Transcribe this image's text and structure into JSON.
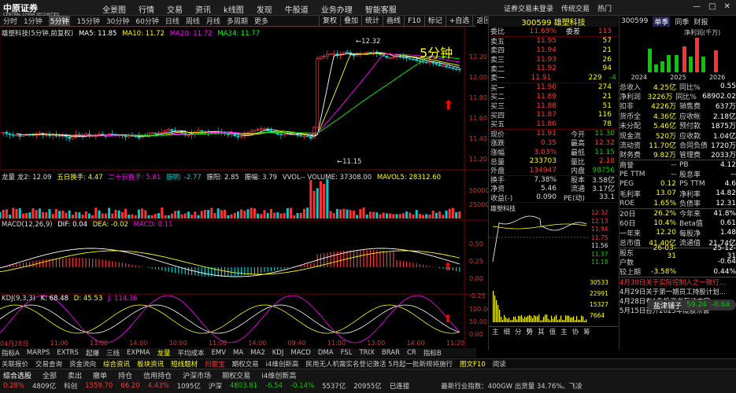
{
  "topbar": {
    "logo": "中原证券",
    "logo_sub": "CENTRAL CHINA SECURITIES",
    "menu": [
      "全景图",
      "行情",
      "交易",
      "资讯",
      "k线图",
      "发现",
      "牛股道",
      "业务办理",
      "智能客服"
    ],
    "right": [
      "证券交易未登录",
      "传统交易",
      "热门",
      "窗",
      "●"
    ]
  },
  "tabs": [
    "分时",
    "1分钟",
    "5分钟",
    "15分钟",
    "30分钟",
    "60分钟",
    "日线",
    "周线",
    "月线",
    "多周期",
    "更多"
  ],
  "tools": [
    "复权",
    "叠加",
    "统计",
    "画线",
    "F10",
    "标记",
    "+自选",
    "返回"
  ],
  "main": {
    "title": "雄塑科技(5分钟,前复权)",
    "ma": [
      {
        "t": "MA5: 11.85",
        "c": "#fff"
      },
      {
        "t": "MA10: 11.72",
        "c": "#ff0"
      },
      {
        "t": "MA20: 11.72",
        "c": "#f0f"
      },
      {
        "t": "MA34: 11.77",
        "c": "#0f0"
      }
    ],
    "label": "5分钟",
    "high": "12.32",
    "low": "11.15",
    "yaxis": [
      "12.20",
      "12.00",
      "11.80",
      "11.60",
      "11.40",
      "11.20"
    ]
  },
  "vol": {
    "title": "龙量 龙2: 12.09",
    "huan": "五日换手: 4.47",
    "huan20": "二十日换手: 5.81",
    "zhenming": "振明: -2.77",
    "zhenfu": "振阳: 2.85",
    "zhenfu2": "振幅: 3.79",
    "vvol": "VVOL-- VOLUME: 37308.00",
    "mavol": "MAVOL5: 28312.60",
    "yaxis": [
      "50000",
      "25000"
    ]
  },
  "macd": {
    "title": "MACD(12,26,9)",
    "dif": "DIF: 0.04",
    "dea": "DEA: -0.02",
    "macd": "MACD: 0.11",
    "yaxis": [
      "0.50",
      "0.25",
      "0.00",
      "-0.25"
    ]
  },
  "kdj": {
    "title": "KDJ(9,3,3)",
    "k": "K: 68.48",
    "d": "D: 45.53",
    "j": "J: 114.36",
    "yaxis": [
      "100.00",
      "50.00",
      "0.00"
    ]
  },
  "xaxis": [
    "04月28日",
    "11:00",
    "13:00",
    "14:00",
    "10:00",
    "11:00",
    "14:00",
    "09:40",
    "11:00",
    "13:00",
    "14:00",
    "11:20"
  ],
  "bottomtabs": [
    "指标A",
    "MARPS",
    "EXTRS",
    "起爆",
    "三线",
    "EXPMA",
    "龙量",
    "平均成本",
    "EMV",
    "MA",
    "MA2",
    "KDJ",
    "MACD",
    "DMA",
    "FSL",
    "TRIX",
    "BRAR",
    "CR",
    "指标B"
  ],
  "bottom2": [
    "关联报价",
    "交易查询",
    "资金流向",
    "综合资讯",
    "板块资讯",
    "短线题材",
    "扫雷宝",
    "期权交易",
    "i4维创新高",
    "民用无人机需实名登记激活 5月起一批新规将施行",
    "图文F10",
    "阅读"
  ],
  "quote": {
    "code": "300599",
    "name": "雄塑科技",
    "weibi_l": "委比",
    "weibi": "11.69%",
    "weicha_l": "委差",
    "weicha": "113",
    "sells": [
      {
        "n": "卖五",
        "p": "11.95",
        "v": "57"
      },
      {
        "n": "卖四",
        "p": "11.94",
        "v": "21"
      },
      {
        "n": "卖三",
        "p": "11.93",
        "v": "26"
      },
      {
        "n": "卖二",
        "p": "11.92",
        "v": "94"
      },
      {
        "n": "卖一",
        "p": "11.91",
        "v": "229",
        "d": "-4"
      }
    ],
    "buys": [
      {
        "n": "买一",
        "p": "11.90",
        "v": "274"
      },
      {
        "n": "买二",
        "p": "11.89",
        "v": "21"
      },
      {
        "n": "买三",
        "p": "11.88",
        "v": "51"
      },
      {
        "n": "买四",
        "p": "11.87",
        "v": "116"
      },
      {
        "n": "买五",
        "p": "11.86",
        "v": "78"
      }
    ],
    "stats": [
      [
        "现价",
        "11.91",
        "今开",
        "11.30"
      ],
      [
        "涨跌",
        "0.35",
        "最高",
        "12.32"
      ],
      [
        "涨幅",
        "3.03%",
        "最低",
        "11.15"
      ],
      [
        "总量",
        "233703",
        "量比",
        "2.18"
      ],
      [
        "外盘",
        "134947",
        "内盘",
        "98756"
      ],
      [
        "换手",
        "7.38%",
        "股本",
        "3.58亿"
      ],
      [
        "净资",
        "5.46",
        "流通",
        "3.17亿"
      ],
      [
        "收益(-)",
        "0.090",
        "PE(动)",
        "33.1"
      ]
    ],
    "mini_title": "雄塑科技",
    "mini_y": [
      "12.32",
      "12.13",
      "11.94",
      "11.75",
      "11.56",
      "11.37",
      "11.18"
    ],
    "mini_vol": [
      "30533",
      "22991",
      "15327",
      "7664"
    ],
    "tabs": [
      "主",
      "细",
      "分",
      "势",
      "其",
      "值",
      "主",
      "协",
      "筹"
    ]
  },
  "fin": {
    "code": "300599",
    "tabs": [
      "单季",
      "同季",
      "财报"
    ],
    "chart_title": "净利润(千万)",
    "years": [
      "2024",
      "2025",
      "2026"
    ],
    "rows": [
      [
        "总收入",
        "4.25亿",
        "同比%",
        "0.55"
      ],
      [
        "净利润",
        "3226万",
        "同比%",
        "68902.02"
      ],
      [
        "扣非",
        "4226万",
        "销售费",
        "637万"
      ],
      [
        "货币全",
        "4.36亿",
        "应收帐",
        "2.18亿"
      ],
      [
        "未分配",
        "5.46亿",
        "预付款",
        "1875万"
      ],
      [
        "现金流",
        "520万",
        "应收款",
        "1.04亿"
      ],
      [
        "流动资",
        "11.70亿",
        "合同负债",
        "1720万"
      ],
      [
        "财务费",
        "9.82万",
        "管理费",
        "2033万"
      ],
      [
        "商誉",
        "--",
        "PB",
        "4.12"
      ],
      [
        "PE TTM",
        "--",
        "股息率",
        "--"
      ],
      [
        "PEG",
        "0.12",
        "PS TTM",
        "4.6"
      ],
      [
        "毛利率",
        "13.07",
        "净利率",
        "14.82"
      ],
      [
        "ROE",
        "1.65%",
        "负债率",
        "12.31"
      ],
      [
        "20日",
        "26.2%",
        "今年来",
        "41.8%"
      ],
      [
        "60日",
        "10.4%",
        "Beta值",
        "0.61"
      ],
      [
        "一年来",
        "12.20",
        "每股净",
        "1.48"
      ],
      [
        "总市值",
        "41.40亿",
        "流通值",
        "21.74亿"
      ],
      [
        "股东",
        "26-03-31",
        "",
        "25-12-31"
      ],
      [
        "户数",
        "",
        "",
        "-0.64"
      ],
      [
        "较上期",
        "-3.58%",
        "",
        "0.44%"
      ]
    ],
    "hover": "盐津铺子",
    "hover_v": "59.24",
    "hover_d": "-0.64",
    "news": [
      "4月30日关于实际控制人之一致行...",
      "4月29日关于第一期员工持股计划...",
      "4月28日有1条投资者互动内容",
      "5月15日召开2025年度股东会"
    ]
  },
  "status": {
    "items": [
      "综合选股",
      "全部",
      "卖出",
      "撤单",
      "持仓",
      "信用持仓",
      "沪深市场",
      "期权交易",
      "i4维创新高"
    ],
    "idx": [
      {
        "n": "上证",
        "v": "4809亿",
        "p": "0.28%"
      },
      {
        "n": "科创",
        "v": "1559.70",
        "p": "66.20"
      },
      {
        "n": "",
        "v": "4.43%",
        "p": "1095亿"
      },
      {
        "n": "沪深",
        "v": "4803.81",
        "p": "-6.54"
      },
      {
        "n": "",
        "v": "-0.14%",
        "p": "5537亿"
      },
      {
        "n": "",
        "v": "20955亿",
        "p": ""
      }
    ],
    "msg": "已连接",
    "r": "最新行业指数：400GW 出货量 34.76%。飞凌"
  }
}
